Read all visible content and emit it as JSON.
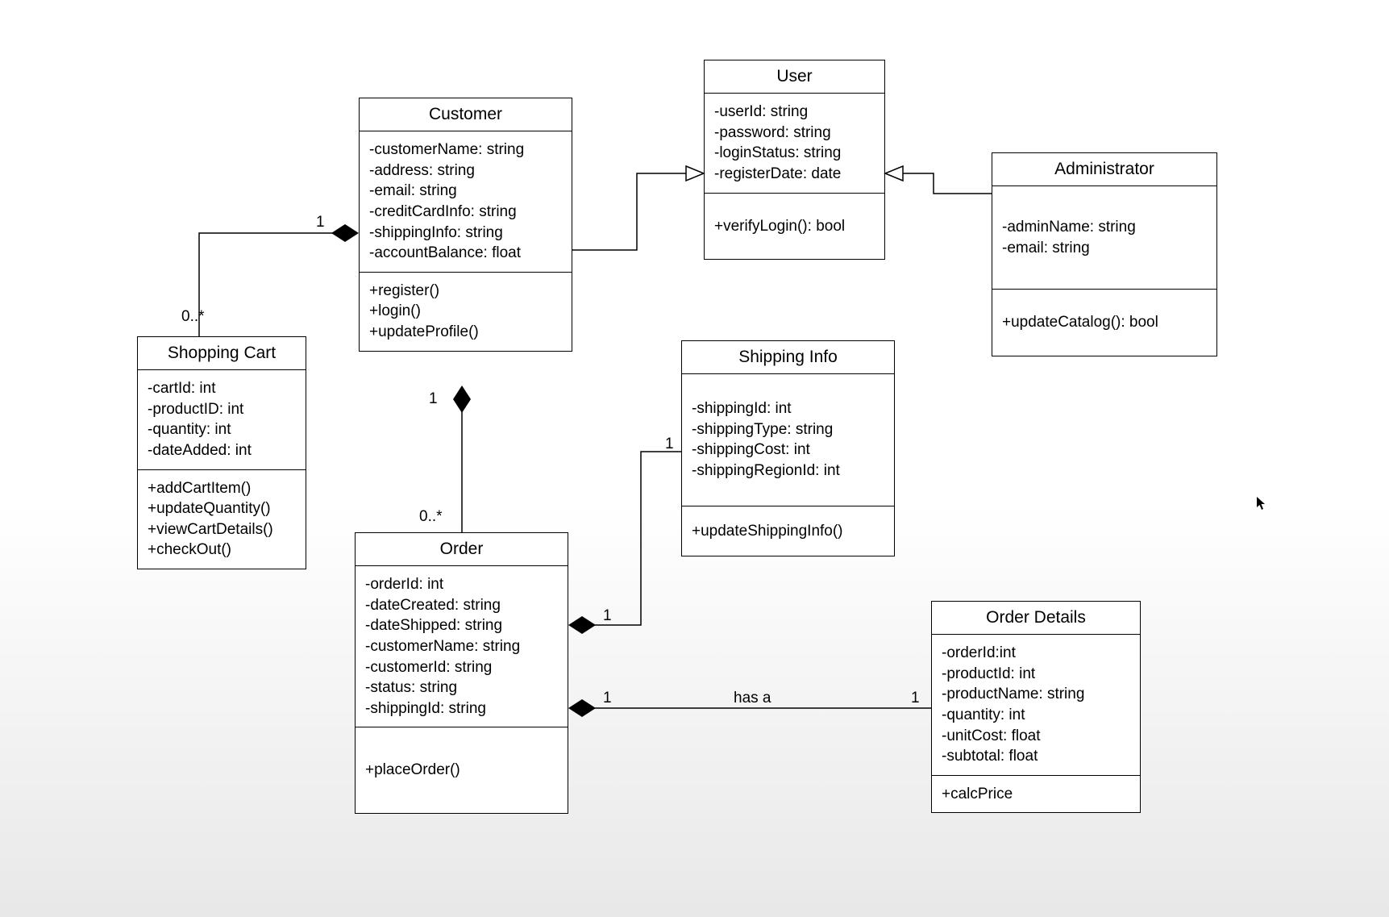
{
  "classes": {
    "customer": {
      "name": "Customer",
      "attributes": [
        "-customerName: string",
        "-address: string",
        "-email: string",
        "-creditCardInfo: string",
        "-shippingInfo: string",
        "-accountBalance: float"
      ],
      "operations": [
        "+register()",
        "+login()",
        "+updateProfile()"
      ]
    },
    "user": {
      "name": "User",
      "attributes": [
        "-userId: string",
        "-password: string",
        "-loginStatus: string",
        "-registerDate: date"
      ],
      "operations": [
        "+verifyLogin(): bool"
      ]
    },
    "administrator": {
      "name": "Administrator",
      "attributes": [
        "-adminName: string",
        "-email: string"
      ],
      "operations": [
        "+updateCatalog(): bool"
      ]
    },
    "shoppingCart": {
      "name": "Shopping Cart",
      "attributes": [
        "-cartId: int",
        "-productID: int",
        "-quantity: int",
        "-dateAdded: int"
      ],
      "operations": [
        "+addCartItem()",
        "+updateQuantity()",
        "+viewCartDetails()",
        "+checkOut()"
      ]
    },
    "order": {
      "name": "Order",
      "attributes": [
        "-orderId: int",
        "-dateCreated: string",
        "-dateShipped: string",
        "-customerName: string",
        "-customerId: string",
        "-status: string",
        "-shippingId: string"
      ],
      "operations": [
        "+placeOrder()"
      ]
    },
    "shippingInfo": {
      "name": "Shipping Info",
      "attributes": [
        "-shippingId: int",
        "-shippingType: string",
        "-shippingCost: int",
        "-shippingRegionId: int"
      ],
      "operations": [
        "+updateShippingInfo()"
      ]
    },
    "orderDetails": {
      "name": "Order Details",
      "attributes": [
        "-orderId:int",
        "-productId: int",
        "-productName: string",
        "-quantity: int",
        "-unitCost: float",
        "-subtotal: float"
      ],
      "operations": [
        "+calcPrice"
      ]
    }
  },
  "multiplicities": {
    "cust_cart_near": "1",
    "cust_cart_far": "0..*",
    "cust_order_near": "1",
    "cust_order_far": "0..*",
    "order_ship_near": "1",
    "order_ship_far": "1",
    "order_det_near": "1",
    "order_det_far": "1"
  },
  "relationLabels": {
    "order_orderDetails": "has a"
  },
  "relationships": [
    {
      "from": "Customer",
      "to": "User",
      "type": "generalization"
    },
    {
      "from": "Administrator",
      "to": "User",
      "type": "generalization"
    },
    {
      "from": "Customer",
      "to": "Shopping Cart",
      "type": "composition",
      "fromMult": "1",
      "toMult": "0..*"
    },
    {
      "from": "Customer",
      "to": "Order",
      "type": "composition",
      "fromMult": "1",
      "toMult": "0..*"
    },
    {
      "from": "Order",
      "to": "Shipping Info",
      "type": "composition",
      "fromMult": "1",
      "toMult": "1"
    },
    {
      "from": "Order",
      "to": "Order Details",
      "type": "composition",
      "label": "has a",
      "fromMult": "1",
      "toMult": "1"
    }
  ]
}
